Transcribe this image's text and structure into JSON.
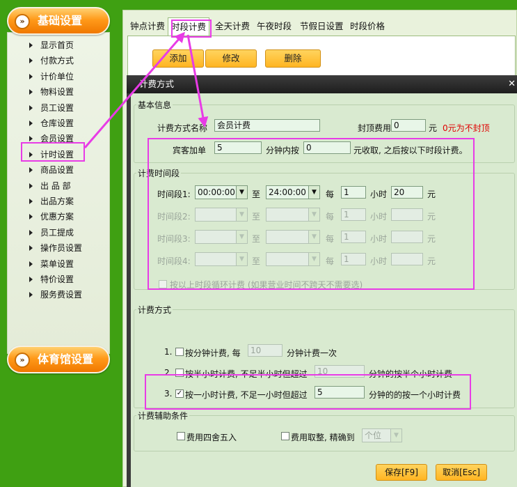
{
  "sidebar": {
    "header": "基础设置",
    "header_icon": "double-chevron-right",
    "items": [
      {
        "label": "显示首页"
      },
      {
        "label": "付款方式"
      },
      {
        "label": "计价单位"
      },
      {
        "label": "物料设置"
      },
      {
        "label": "员工设置"
      },
      {
        "label": "仓库设置"
      },
      {
        "label": "会员设置"
      },
      {
        "label": "计时设置"
      },
      {
        "label": "商品设置"
      },
      {
        "label": "出 品 部"
      },
      {
        "label": "出品方案"
      },
      {
        "label": "优惠方案"
      },
      {
        "label": "员工提成"
      },
      {
        "label": "操作员设置"
      },
      {
        "label": "菜单设置"
      },
      {
        "label": "特价设置"
      },
      {
        "label": "服务费设置"
      }
    ],
    "footer": "体育馆设置"
  },
  "tabs": [
    {
      "label": "钟点计费"
    },
    {
      "label": "时段计费"
    },
    {
      "label": "全天计费"
    },
    {
      "label": "午夜时段"
    },
    {
      "label": "节假日设置"
    },
    {
      "label": "时段价格"
    }
  ],
  "toolbar": {
    "add": "添加",
    "edit": "修改",
    "delete": "删除"
  },
  "dialog": {
    "title": "计费方式",
    "basic": {
      "group_title": "基本信息",
      "name_label": "计费方式名称",
      "name_value": "会员计费",
      "cap_label": "封顶费用",
      "cap_value": "0",
      "cap_unit": "元",
      "cap_hint": "0元为不封顶",
      "guest_label": "宾客加单",
      "guest_value": "5",
      "within_label": "分钟内按",
      "within_value": "0",
      "after_text": "元收取, 之后按以下时段计费。"
    },
    "periods": {
      "group_title": "计费时间段",
      "rows": [
        {
          "label": "时间段1:",
          "start": "00:00:00",
          "to": "至",
          "end": "24:00:00",
          "every": "每",
          "hours": "1",
          "hour_unit": "小时",
          "price": "20",
          "price_unit": "元"
        },
        {
          "label": "时间段2:",
          "start": "",
          "to": "至",
          "end": "",
          "every": "每",
          "hours": "1",
          "hour_unit": "小时",
          "price": "",
          "price_unit": "元"
        },
        {
          "label": "时间段3:",
          "start": "",
          "to": "至",
          "end": "",
          "every": "每",
          "hours": "1",
          "hour_unit": "小时",
          "price": "",
          "price_unit": "元"
        },
        {
          "label": "时间段4:",
          "start": "",
          "to": "至",
          "end": "",
          "every": "每",
          "hours": "1",
          "hour_unit": "小时",
          "price": "",
          "price_unit": "元"
        }
      ],
      "loop_label": "按以上时段循环计费 (如果营业时间不跨天不需要选)"
    },
    "method": {
      "group_title": "计费方式",
      "opt1": {
        "num": "1.",
        "label": "按分钟计费, 每",
        "value": "10",
        "suffix": "分钟计费一次",
        "checked": false
      },
      "opt2": {
        "num": "2.",
        "label": "按半小时计费, 不足半小时但超过",
        "value": "10",
        "suffix": "分钟的按半个小时计费",
        "checked": false
      },
      "opt3": {
        "num": "3.",
        "label": "按一小时计费, 不足一小时但超过",
        "value": "5",
        "suffix": "分钟的的按一个小时计费",
        "checked": true
      }
    },
    "aux": {
      "group_title": "计费辅助条件",
      "round_label": "费用四舍五入",
      "integer_label": "费用取整, 精确到",
      "precision_value": "个位"
    },
    "save": "保存[F9]",
    "cancel": "取消[Esc]"
  },
  "colors": {
    "accent": "#ff9a1a",
    "highlight": "#e83be6",
    "hint_red": "#e00000"
  }
}
